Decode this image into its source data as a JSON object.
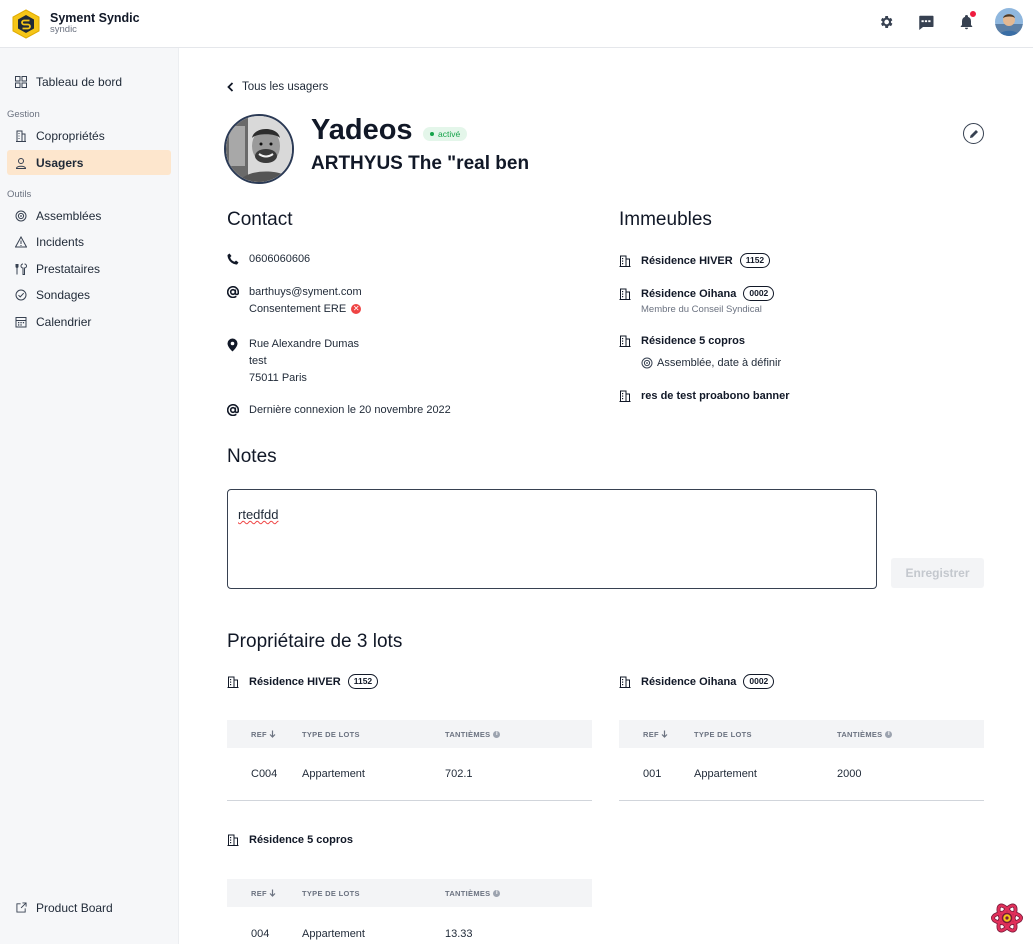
{
  "brand": {
    "name": "Syment Syndic",
    "subtitle": "syndic"
  },
  "topbar": {
    "icons": [
      "gear-icon",
      "chat-icon",
      "bell-icon",
      "user-avatar"
    ]
  },
  "sidebar": {
    "dashboard": "Tableau de bord",
    "section_gestion": "Gestion",
    "coproprietes": "Copropriétés",
    "usagers": "Usagers",
    "section_outils": "Outils",
    "assemblees": "Assemblées",
    "incidents": "Incidents",
    "prestataires": "Prestataires",
    "sondages": "Sondages",
    "calendrier": "Calendrier",
    "product_board": "Product Board"
  },
  "page": {
    "back_label": "Tous les usagers",
    "user_name": "Yadeos",
    "status": "activé",
    "user_subtitle": "ARTHYUS The \"real ben"
  },
  "contact": {
    "title": "Contact",
    "phone": "0606060606",
    "email": "barthuys@syment.com",
    "consent": "Consentement ERE",
    "address_line1": "Rue Alexandre Dumas",
    "address_line2": "test",
    "address_line3": "75011 Paris",
    "last_login": "Dernière connexion le 20 novembre 2022"
  },
  "immeubles": {
    "title": "Immeubles",
    "items": [
      {
        "name": "Résidence HIVER",
        "code": "1152"
      },
      {
        "name": "Résidence Oihana",
        "code": "0002",
        "role": "Membre du Conseil Syndical"
      },
      {
        "name": "Résidence 5 copros",
        "assembly": "Assemblée, date à définir"
      },
      {
        "name": "res de test proabono banner"
      }
    ]
  },
  "notes": {
    "title": "Notes",
    "value": "rtedfdd",
    "save_label": "Enregistrer"
  },
  "lots": {
    "title": "Propriétaire de 3 lots",
    "columns": {
      "ref": "REF",
      "type": "TYPE DE LOTS",
      "tantiemes": "TANTIÈMES"
    },
    "groups": [
      {
        "name": "Résidence HIVER",
        "code": "1152",
        "rows": [
          {
            "ref": "C004",
            "type": "Appartement",
            "tantiemes": "702.1"
          }
        ]
      },
      {
        "name": "Résidence Oihana",
        "code": "0002",
        "rows": [
          {
            "ref": "001",
            "type": "Appartement",
            "tantiemes": "2000"
          }
        ]
      },
      {
        "name": "Résidence 5 copros",
        "rows": [
          {
            "ref": "004",
            "type": "Appartement",
            "tantiemes": "13.33"
          }
        ]
      }
    ]
  },
  "colors": {
    "accent": "#f5c518",
    "active_nav": "#fde6cd",
    "status_green": "#16a34a",
    "notif_red": "#ef1c3f"
  }
}
